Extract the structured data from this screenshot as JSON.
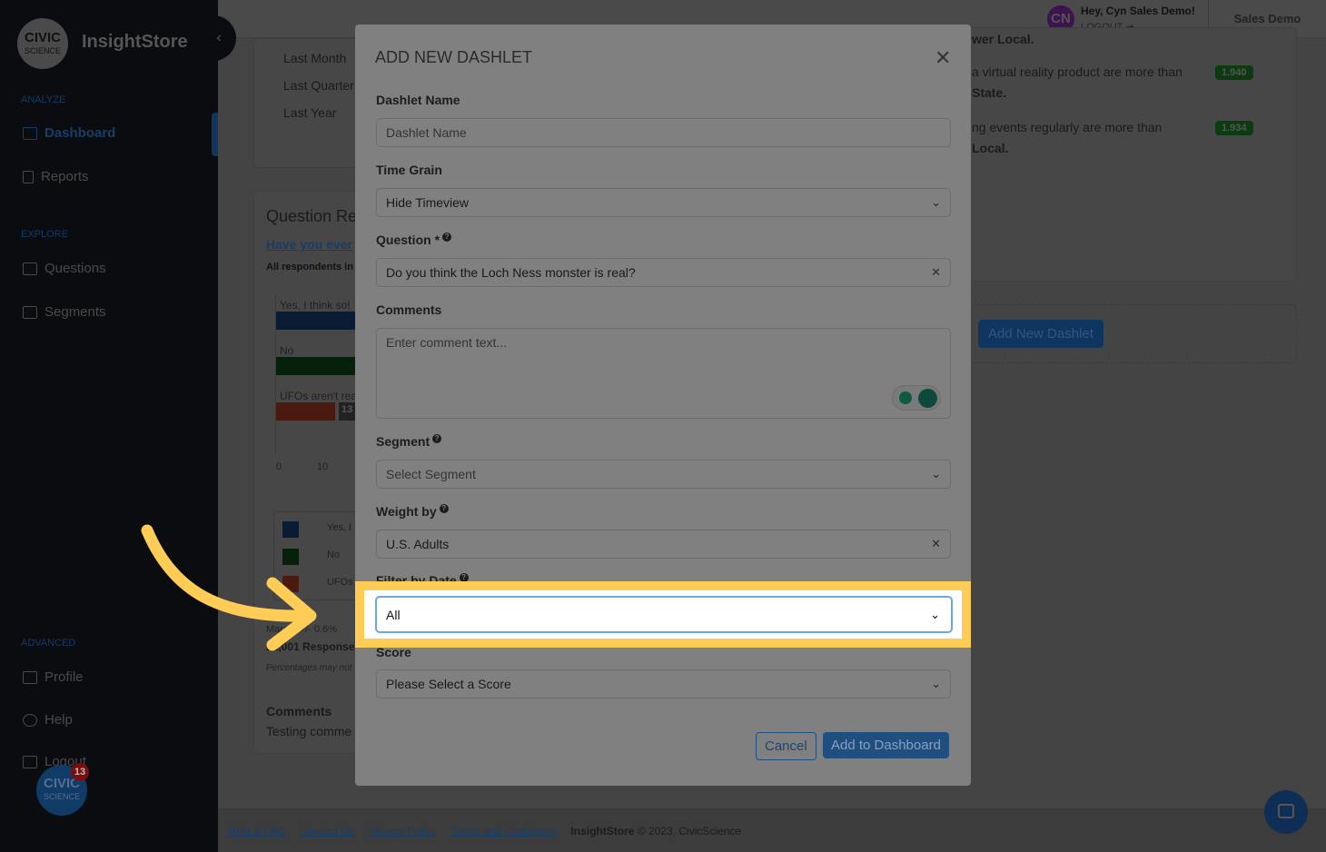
{
  "sidebar": {
    "brand": "InsightStore",
    "logo_text": "CIVIC",
    "logo_sub": "SCIENCE",
    "sections": {
      "analyze": "ANALYZE",
      "explore": "EXPLORE",
      "advanced": "ADVANCED"
    },
    "items": [
      {
        "label": "Dashboard",
        "icon": "dashboard-icon"
      },
      {
        "label": "Reports",
        "icon": "report-icon"
      },
      {
        "label": "Questions",
        "icon": "question-icon"
      },
      {
        "label": "Segments",
        "icon": "segments-icon"
      },
      {
        "label": "Profile",
        "icon": "profile-icon"
      },
      {
        "label": "Help",
        "icon": "help-icon"
      },
      {
        "label": "Logout",
        "icon": "logout-icon"
      }
    ],
    "notification_count": "13"
  },
  "header": {
    "avatar": "CN",
    "greeting": "Hey, Cyn Sales Demo!",
    "logout": "LOGOUT",
    "account": "Sales Demo"
  },
  "background": {
    "date_options": [
      "Last Month",
      "Last Quarter",
      "Last Year"
    ],
    "question_card": {
      "title": "Question Re",
      "link": "Have you ever",
      "sub": "All respondents in",
      "bars": [
        {
          "label": "Yes, I think so!",
          "color": "#0a1c33"
        },
        {
          "label": "No",
          "color": "#06200c"
        },
        {
          "label": "UFOs aren't real",
          "color": "#4a1a10",
          "value": "13"
        }
      ],
      "axis": [
        "0",
        "10"
      ],
      "legend": [
        "Yes, I",
        "No",
        "UFOs"
      ],
      "margin": "Margin +/- 0.6%",
      "responses": "21,001 Responses",
      "note": "Percentages may not",
      "comments_label": "Comments",
      "comments_text": "Testing comme"
    },
    "insights": [
      {
        "text": "wer Local."
      },
      {
        "text": "a virtual reality product are more than",
        "tail": "State.",
        "score": "1.940"
      },
      {
        "text": "ng events regularly are more than",
        "tail": "Local.",
        "score": "1.934"
      }
    ],
    "add_dashlet": "Add New Dashlet"
  },
  "modal": {
    "title": "ADD NEW DASHLET",
    "dashlet_name": {
      "label": "Dashlet Name",
      "placeholder": "Dashlet Name"
    },
    "time_grain": {
      "label": "Time Grain",
      "value": "Hide Timeview"
    },
    "question": {
      "label": "Question",
      "required": "*",
      "value": "Do you think the Loch Ness monster is real?"
    },
    "comments": {
      "label": "Comments",
      "placeholder": "Enter comment text..."
    },
    "segment": {
      "label": "Segment",
      "placeholder": "Select Segment"
    },
    "weight": {
      "label": "Weight by",
      "value": "U.S. Adults"
    },
    "filter_date": {
      "label": "Filter by Date",
      "value": "All"
    },
    "score": {
      "label": "Score",
      "placeholder": "Please Select a Score"
    },
    "cancel": "Cancel",
    "submit": "Add to Dashboard"
  },
  "footer": {
    "links": [
      "Help & FAQ",
      "Contact Us",
      "Privacy Policy",
      "Terms and Conditions"
    ],
    "brand": "InsightStore",
    "copyright": " © 2023, CivicScience"
  },
  "colors": {
    "highlight": "#ffcc55",
    "accent": "#2a6fc0"
  }
}
